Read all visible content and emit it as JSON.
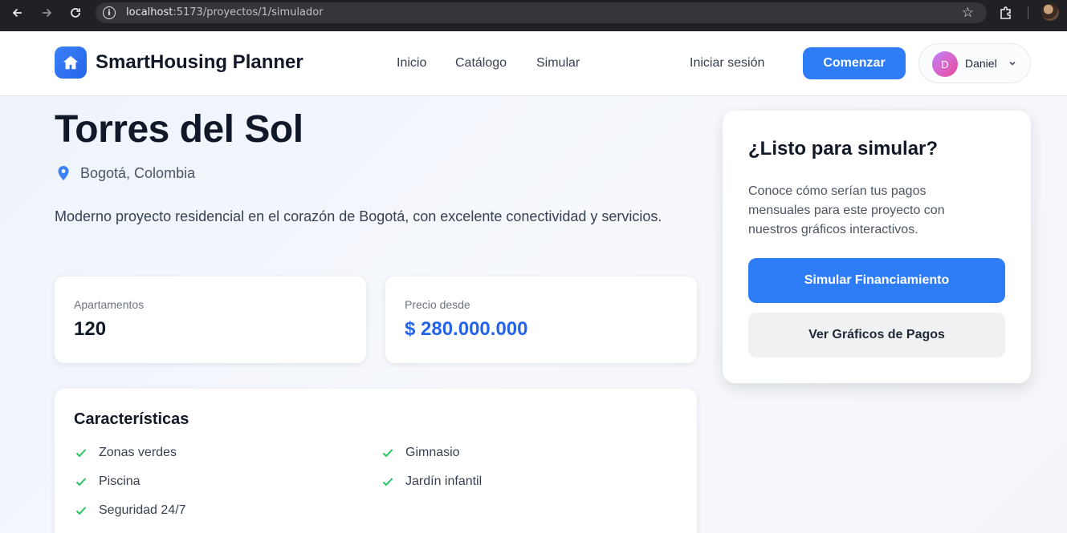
{
  "browser": {
    "url_host": "localhost",
    "url_path": ":5173/proyectos/1/simulador"
  },
  "header": {
    "brand": "SmartHousing Planner",
    "nav": [
      "Inicio",
      "Catálogo",
      "Simular"
    ],
    "login_label": "Iniciar sesión",
    "start_label": "Comenzar",
    "user": {
      "initial": "D",
      "name": "Daniel"
    }
  },
  "project": {
    "title": "Torres del Sol",
    "location": "Bogotá, Colombia",
    "description": "Moderno proyecto residencial en el corazón de Bogotá, con excelente conectividad y servicios.",
    "stats": {
      "apartments_label": "Apartamentos",
      "apartments_value": "120",
      "price_label": "Precio desde",
      "price_value": "$ 280.000.000"
    },
    "features_title": "Características",
    "features": [
      "Zonas verdes",
      "Gimnasio",
      "Piscina",
      "Jardín infantil",
      "Seguridad 24/7"
    ]
  },
  "simulator": {
    "title": "¿Listo para simular?",
    "text": "Conoce cómo serían tus pagos mensuales para este proyecto con nuestros gráficos interactivos.",
    "primary_label": "Simular Financiamiento",
    "secondary_label": "Ver Gráficos de Pagos"
  },
  "colors": {
    "accent": "#2f7df6",
    "price": "#2563eb",
    "check": "#22c55e"
  },
  "icons": [
    "arrow-left-icon",
    "arrow-right-icon",
    "reload-icon",
    "info-icon",
    "star-icon",
    "extensions-icon",
    "home-icon",
    "chevron-down-icon",
    "location-pin-icon",
    "check-icon"
  ]
}
